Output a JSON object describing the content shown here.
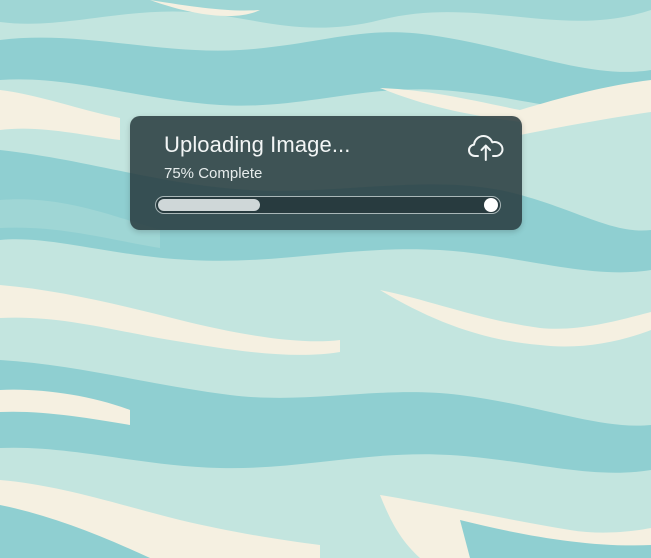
{
  "upload": {
    "title": "Uploading Image...",
    "status": "75% Complete",
    "icon": "cloud-upload-icon",
    "progress_fill_fraction": 0.3
  },
  "colors": {
    "background": "#c3e5df",
    "wave_teal": "#8fcfd1",
    "wave_cream": "#f5f0e1",
    "card": "#283a3e"
  }
}
